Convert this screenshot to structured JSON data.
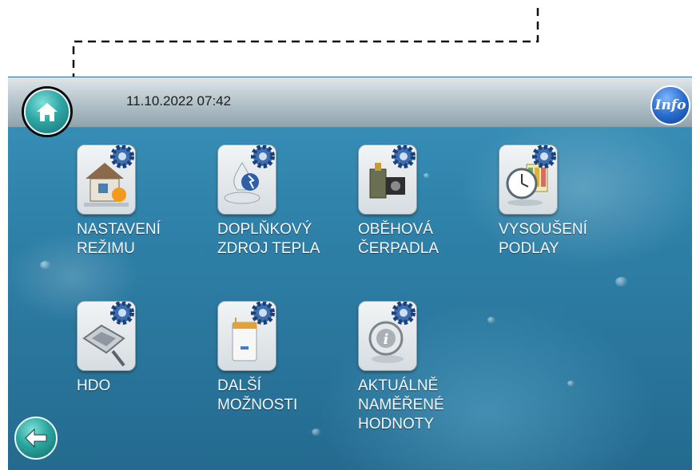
{
  "header": {
    "datetime": "11.10.2022 07:42",
    "info_label": "Info"
  },
  "tiles": [
    {
      "line1": "NASTAVENÍ",
      "line2": "REŽIMU",
      "line3": "",
      "icon": "house-settings-icon"
    },
    {
      "line1": "DOPLŇKOVÝ",
      "line2": "ZDROJ TEPLA",
      "line3": "",
      "icon": "heat-source-icon"
    },
    {
      "line1": "OBĚHOVÁ",
      "line2": "ČERPADLA",
      "line3": "",
      "icon": "pump-icon"
    },
    {
      "line1": "VYSOUŠENÍ",
      "line2": "PODLAY",
      "line3": "",
      "icon": "clock-calendar-icon"
    },
    {
      "line1": "HDO",
      "line2": "",
      "line3": "",
      "icon": "connector-icon"
    },
    {
      "line1": "DALŠÍ",
      "line2": "MOŽNOSTI",
      "line3": "",
      "icon": "boiler-icon"
    },
    {
      "line1": "AKTUÁLNĚ",
      "line2": "NAMĚŘENÉ",
      "line3": "HODNOTY",
      "icon": "info-measure-icon"
    }
  ],
  "colors": {
    "panel_blue": "#2f82aa",
    "topbar": "#b9c6cd",
    "home_teal": "#2fa7a5",
    "info_blue": "#2a6fd0"
  }
}
